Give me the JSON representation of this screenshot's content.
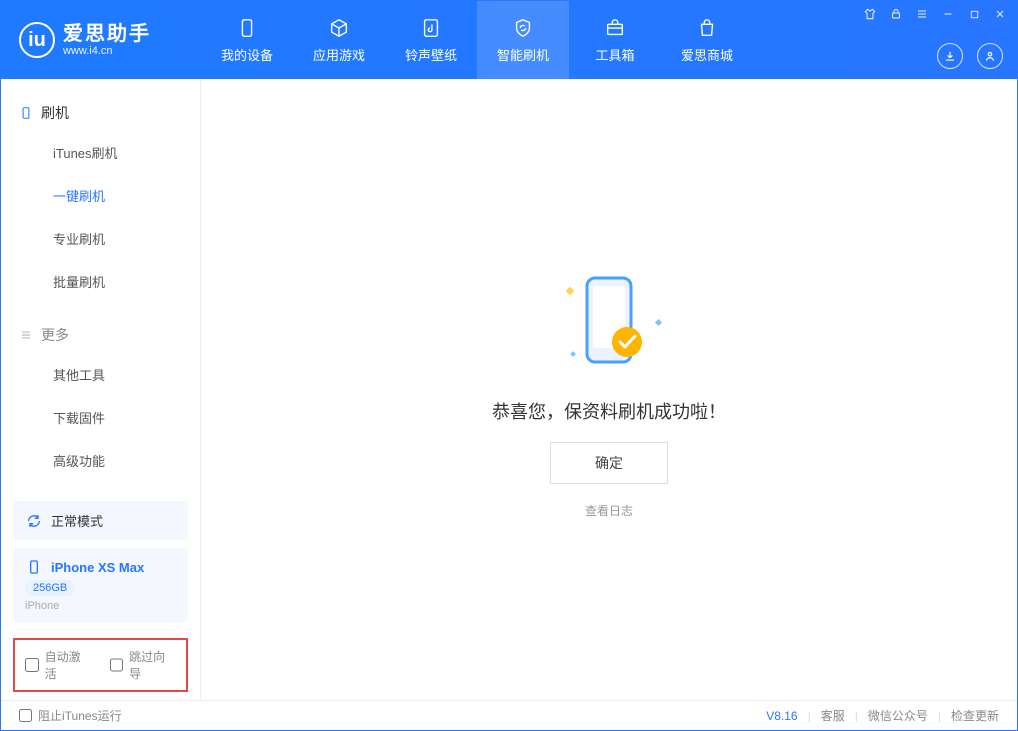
{
  "app": {
    "title": "爱思助手",
    "subtitle": "www.i4.cn"
  },
  "nav": {
    "tabs": [
      {
        "label": "我的设备"
      },
      {
        "label": "应用游戏"
      },
      {
        "label": "铃声壁纸"
      },
      {
        "label": "智能刷机"
      },
      {
        "label": "工具箱"
      },
      {
        "label": "爱思商城"
      }
    ]
  },
  "sidebar": {
    "group1_label": "刷机",
    "items1": [
      {
        "label": "iTunes刷机"
      },
      {
        "label": "一键刷机"
      },
      {
        "label": "专业刷机"
      },
      {
        "label": "批量刷机"
      }
    ],
    "group2_label": "更多",
    "items2": [
      {
        "label": "其他工具"
      },
      {
        "label": "下载固件"
      },
      {
        "label": "高级功能"
      }
    ]
  },
  "device": {
    "mode_label": "正常模式",
    "name": "iPhone XS Max",
    "storage": "256GB",
    "type": "iPhone"
  },
  "options": {
    "auto_activate": "自动激活",
    "skip_guide": "跳过向导"
  },
  "main": {
    "success_text": "恭喜您，保资料刷机成功啦！",
    "ok_button": "确定",
    "view_log": "查看日志"
  },
  "footer": {
    "block_itunes": "阻止iTunes运行",
    "version": "V8.16",
    "support": "客服",
    "wechat": "微信公众号",
    "check_update": "检查更新"
  }
}
